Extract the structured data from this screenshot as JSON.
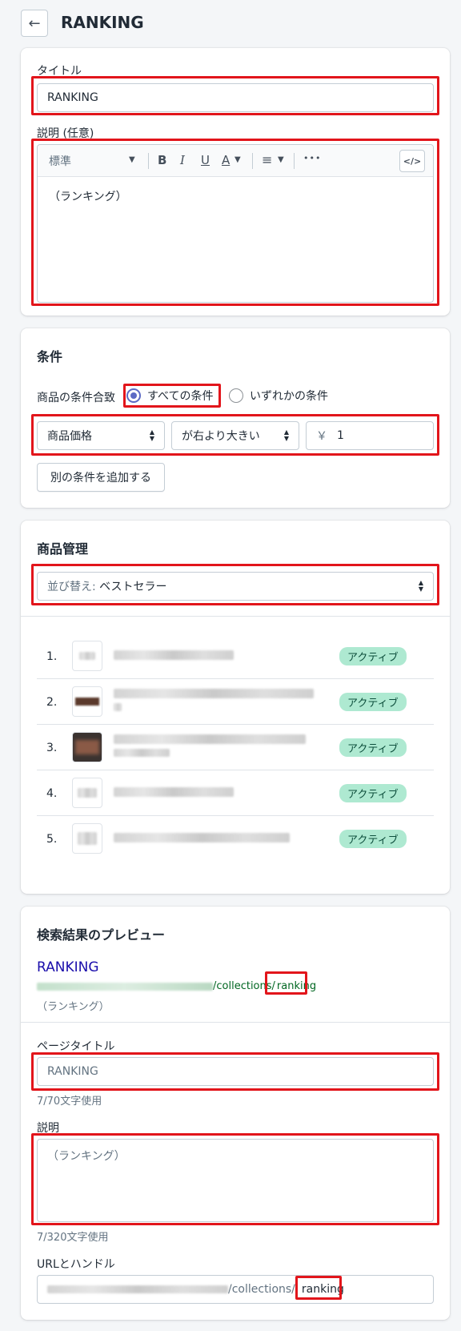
{
  "header": {
    "back_label": "←",
    "title": "RANKING"
  },
  "details": {
    "title_label": "タイトル",
    "title_value": "RANKING",
    "desc_label": "説明 (任意)",
    "editor": {
      "style_select": "標準",
      "bold": "B",
      "italic": "I",
      "underline": "U",
      "color": "A",
      "align": "≡",
      "more": "•••",
      "html": "</>"
    },
    "desc_value": "（ランキング）"
  },
  "conditions": {
    "heading": "条件",
    "match_label": "商品の条件合致",
    "radio_all": "すべての条件",
    "radio_any": "いずれかの条件",
    "radio_selected": "all",
    "field_select": "商品価格",
    "relation_select": "が右より大きい",
    "currency": "￥",
    "value": "1",
    "add_button": "別の条件を追加する"
  },
  "products": {
    "heading": "商品管理",
    "sort_prefix": "並び替え: ",
    "sort_value": "ベストセラー",
    "items": [
      {
        "index": "1.",
        "status": "アクティブ"
      },
      {
        "index": "2.",
        "status": "アクティブ"
      },
      {
        "index": "3.",
        "status": "アクティブ"
      },
      {
        "index": "4.",
        "status": "アクティブ"
      },
      {
        "index": "5.",
        "status": "アクティブ"
      }
    ]
  },
  "seo": {
    "heading": "検索結果のプレビュー",
    "preview_title": "RANKING",
    "preview_url_path": "/collections/",
    "preview_handle": "ranking",
    "preview_desc": "（ランキング）",
    "page_title_label": "ページタイトル",
    "page_title_placeholder": "RANKING",
    "page_title_count": "7/70文字使用",
    "desc_label": "説明",
    "desc_placeholder": "（ランキング）",
    "desc_count": "7/320文字使用",
    "url_label": "URLとハンドル",
    "url_path": "/collections/",
    "url_handle": "ranking"
  },
  "colors": {
    "highlight": "#e2151b",
    "badge_bg": "#aee9d1",
    "link_blue": "#1a0dab",
    "url_green": "#006621",
    "radio_accent": "#5c6ac4"
  }
}
